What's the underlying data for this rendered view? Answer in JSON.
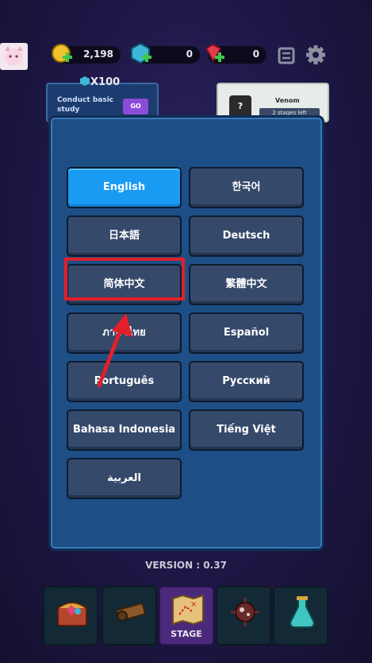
{
  "top_bar": {
    "coins": "2,198",
    "gems": "0",
    "rubies": "0"
  },
  "quest": {
    "reward": "X100",
    "text": "Conduct basic study",
    "go_label": "GO"
  },
  "boss": {
    "name": "Venom",
    "sub": "2 stages left"
  },
  "languages": [
    {
      "label": "English"
    },
    {
      "label": "한국어"
    },
    {
      "label": "日本語"
    },
    {
      "label": "Deutsch"
    },
    {
      "label": "简体中文"
    },
    {
      "label": "繁體中文"
    },
    {
      "label": "ภาษาไทย"
    },
    {
      "label": "Español"
    },
    {
      "label": "Português"
    },
    {
      "label": "Русский"
    },
    {
      "label": "Bahasa Indonesia"
    },
    {
      "label": "Tiếng Việt"
    },
    {
      "label": "العربية"
    }
  ],
  "selected_language": "English",
  "version": "VERSION : 0.37",
  "nav": {
    "stage_label": "STAGE"
  },
  "colors": {
    "selected": "#1a9bf3",
    "button": "#35496b",
    "modal": "#1d4f86",
    "highlight": "#e1202a"
  }
}
